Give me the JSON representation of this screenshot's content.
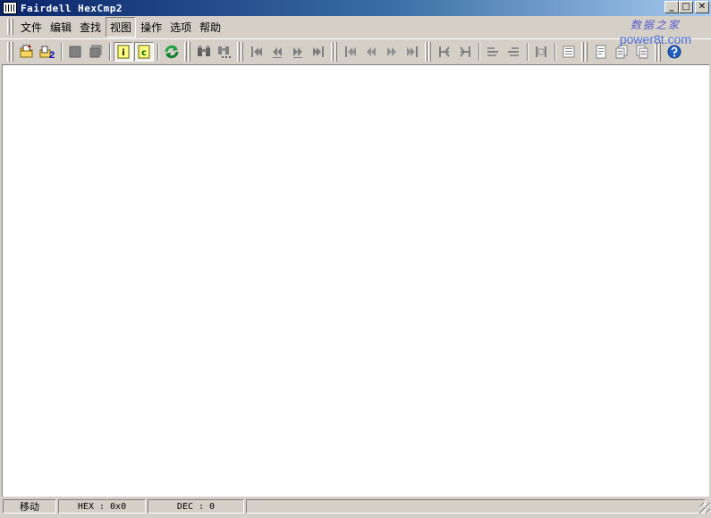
{
  "window": {
    "title": "Fairdell HexCmp2",
    "minimize_glyph": "_",
    "maximize_glyph": "□",
    "close_glyph": "✕"
  },
  "watermark": {
    "line1": "数据之家",
    "line2": "power8t.com"
  },
  "menu": {
    "items": [
      {
        "label": "文件"
      },
      {
        "label": "编辑"
      },
      {
        "label": "查找"
      },
      {
        "label": "视图",
        "active": true
      },
      {
        "label": "操作"
      },
      {
        "label": "选项"
      },
      {
        "label": "帮助"
      }
    ]
  },
  "toolbar": {
    "open_file2_badge": "2",
    "info_view_letter": "i",
    "compare_view_letter": "c",
    "icons": [
      "open-file-1-icon",
      "open-file-2-icon",
      "view-single-icon",
      "view-dual-icon",
      "info-view-icon",
      "compare-view-icon",
      "refresh-icon",
      "find-icon",
      "find-next-icon",
      "first-diff-icon",
      "prev-diff-icon",
      "next-diff-icon",
      "last-diff-icon",
      "first-block-icon",
      "prev-block-icon",
      "next-block-icon",
      "last-block-icon",
      "sync-left-icon",
      "sync-right-icon",
      "align-up-icon",
      "align-down-icon",
      "columns-icon",
      "list-icon",
      "report-icon",
      "copy-left-icon",
      "copy-right-icon",
      "help-icon"
    ]
  },
  "status": {
    "mode": "移动",
    "hex": "HEX : 0x0",
    "dec": "DEC : 0",
    "extra": ""
  },
  "colors": {
    "title_start": "#0a246a",
    "title_end": "#a6caf0",
    "face": "#d4d0c8",
    "client_bg": "#ffffff",
    "watermark": "#5a5acc",
    "help_blue": "#2060c0",
    "refresh_green": "#20a040"
  }
}
